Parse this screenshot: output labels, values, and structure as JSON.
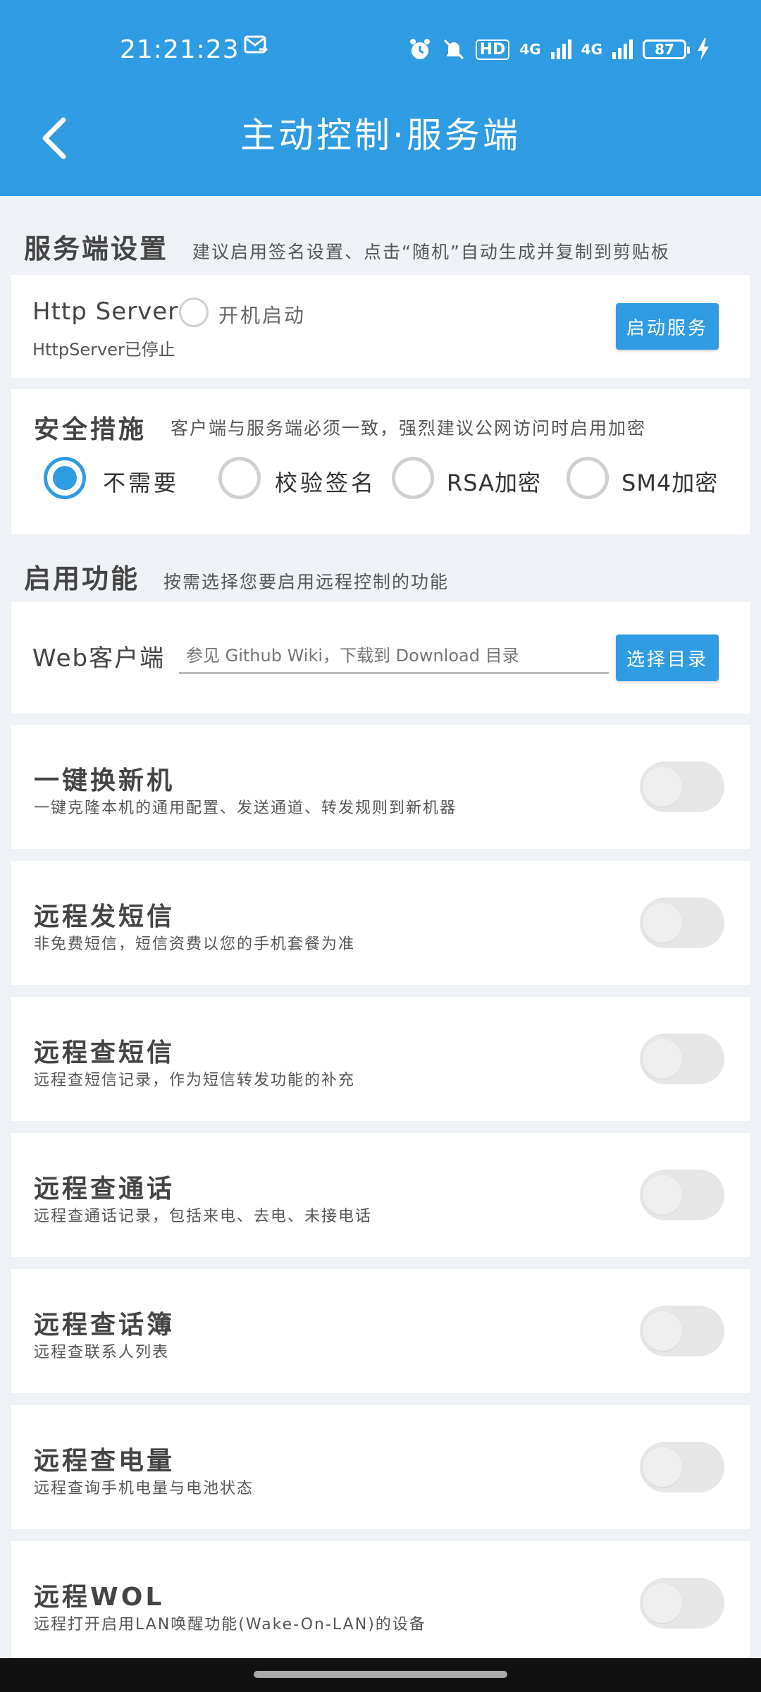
{
  "status_bar": {
    "time": "21:21:23",
    "hd": "HD",
    "net1": "4G",
    "net2": "4G",
    "battery": "87"
  },
  "header": {
    "title": "主动控制·服务端"
  },
  "server_settings": {
    "heading": "服务端设置",
    "desc": "建议启用签名设置、点击“随机”自动生成并复制到剪贴板",
    "server_name": "Http Server",
    "autostart_label": "开机启动",
    "status_text": "HttpServer已停止",
    "start_button": "启动服务"
  },
  "security": {
    "heading": "安全措施",
    "desc": "客户端与服务端必须一致，强烈建议公网访问时启用加密",
    "options": [
      "不需要",
      "校验签名",
      "RSA加密",
      "SM4加密"
    ],
    "selected": "不需要"
  },
  "features": {
    "heading": "启用功能",
    "desc": "按需选择您要启用远程控制的功能",
    "web_client_label": "Web客户端",
    "web_client_placeholder": "参见 Github Wiki，下载到 Download 目录",
    "select_dir_button": "选择目录",
    "items": [
      {
        "title": "一键换新机",
        "desc": "一键克隆本机的通用配置、发送通道、转发规则到新机器",
        "enabled": false
      },
      {
        "title": "远程发短信",
        "desc": "非免费短信，短信资费以您的手机套餐为准",
        "enabled": false
      },
      {
        "title": "远程查短信",
        "desc": "远程查短信记录，作为短信转发功能的补充",
        "enabled": false
      },
      {
        "title": "远程查通话",
        "desc": "远程查通话记录，包括来电、去电、未接电话",
        "enabled": false
      },
      {
        "title": "远程查话簿",
        "desc": "远程查联系人列表",
        "enabled": false
      },
      {
        "title": "远程查电量",
        "desc": "远程查询手机电量与电池状态",
        "enabled": false
      },
      {
        "title": "远程WOL",
        "desc": "远程打开启用LAN唤醒功能(Wake-On-LAN)的设备",
        "enabled": false
      }
    ]
  },
  "colors": {
    "primary": "#2f9be3",
    "background": "#eef1f6",
    "switch_off": "#e6e6e6"
  }
}
